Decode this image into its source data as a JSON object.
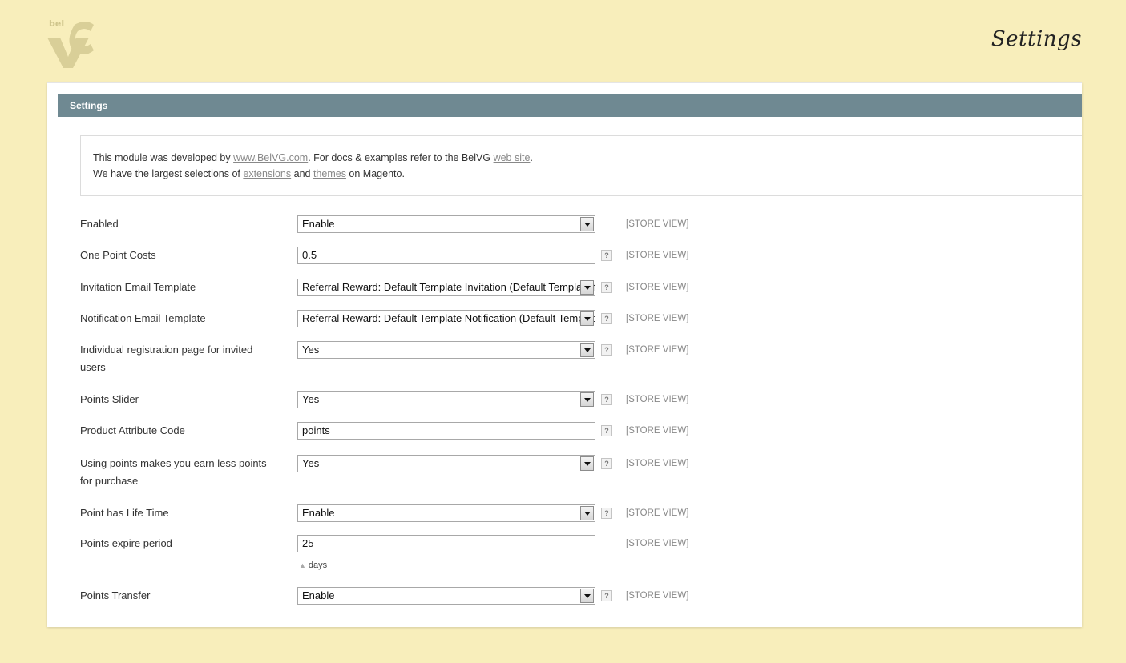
{
  "header": {
    "logo_text": "bel",
    "page_heading": "Settings"
  },
  "section": {
    "title": "Settings"
  },
  "info": {
    "line1_prefix": "This module was developed by ",
    "line1_link": "www.BelVG.com",
    "line1_middle": ". For docs & examples refer to the BelVG ",
    "line1_link2": "web site",
    "line1_suffix": ".",
    "line2_prefix": "We have the largest selections of ",
    "line2_link1": "extensions",
    "line2_middle": " and ",
    "line2_link2": "themes",
    "line2_suffix": " on Magento."
  },
  "fields": [
    {
      "label": "Enabled",
      "value": "Enable",
      "type": "select",
      "scope": "[STORE VIEW]",
      "help": ""
    },
    {
      "label": "One Point Costs",
      "value": "0.5",
      "type": "text",
      "scope": "[STORE VIEW]",
      "help": "?"
    },
    {
      "label": "Invitation Email Template",
      "value": "Referral Reward: Default Template Invitation (Default Template from Locale)",
      "type": "select",
      "scope": "[STORE VIEW]",
      "help": "?"
    },
    {
      "label": "Notification Email Template",
      "value": "Referral Reward: Default Template Notification (Default Template from Locale)",
      "type": "select",
      "scope": "[STORE VIEW]",
      "help": "?"
    },
    {
      "label": "Individual registration page for invited users",
      "value": "Yes",
      "type": "select",
      "scope": "[STORE VIEW]",
      "help": "?"
    },
    {
      "label": "Points Slider",
      "value": "Yes",
      "type": "select",
      "scope": "[STORE VIEW]",
      "help": "?"
    },
    {
      "label": "Product Attribute Code",
      "value": "points",
      "type": "text",
      "scope": "[STORE VIEW]",
      "help": "?"
    },
    {
      "label": "Using points makes you earn less points for purchase",
      "value": "Yes",
      "type": "select",
      "scope": "[STORE VIEW]",
      "help": "?"
    },
    {
      "label": "Point has Life Time",
      "value": "Enable",
      "type": "select",
      "scope": "[STORE VIEW]",
      "help": "?"
    },
    {
      "label": "Points expire period",
      "value": "25",
      "type": "text",
      "scope": "[STORE VIEW]",
      "help": "",
      "note": "days"
    },
    {
      "label": "Points Transfer",
      "value": "Enable",
      "type": "select",
      "scope": "[STORE VIEW]",
      "help": "?"
    }
  ]
}
